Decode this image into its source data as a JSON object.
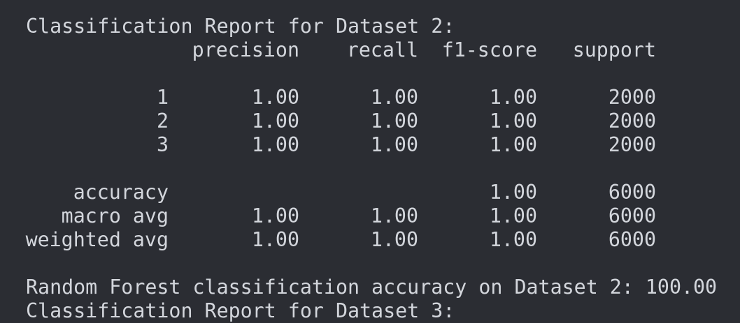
{
  "report": {
    "title": "Classification Report for Dataset 2:",
    "headers": {
      "precision": "precision",
      "recall": "recall",
      "f1": "f1-score",
      "support": "support"
    },
    "class_rows": [
      {
        "label": "1",
        "precision": "1.00",
        "recall": "1.00",
        "f1": "1.00",
        "support": "2000"
      },
      {
        "label": "2",
        "precision": "1.00",
        "recall": "1.00",
        "f1": "1.00",
        "support": "2000"
      },
      {
        "label": "3",
        "precision": "1.00",
        "recall": "1.00",
        "f1": "1.00",
        "support": "2000"
      }
    ],
    "summary_rows": [
      {
        "label": "accuracy",
        "precision": "",
        "recall": "",
        "f1": "1.00",
        "support": "6000"
      },
      {
        "label": "macro avg",
        "precision": "1.00",
        "recall": "1.00",
        "f1": "1.00",
        "support": "6000"
      },
      {
        "label": "weighted avg",
        "precision": "1.00",
        "recall": "1.00",
        "f1": "1.00",
        "support": "6000"
      }
    ]
  },
  "result_line": "Random Forest classification accuracy on Dataset 2: 100.00",
  "next_title_partial": "Classification Report for Dataset 3:"
}
